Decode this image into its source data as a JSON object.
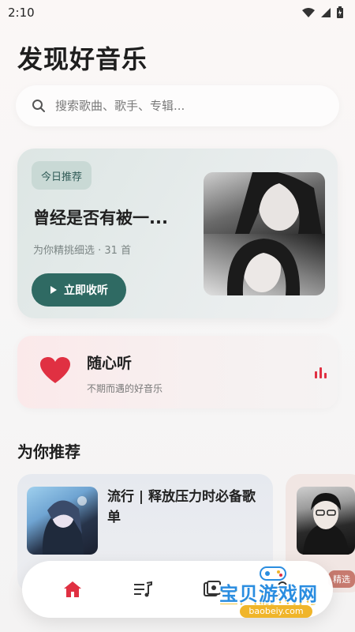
{
  "status_bar": {
    "time": "2:10"
  },
  "header": {
    "title": "发现好音乐"
  },
  "search": {
    "placeholder": "搜索歌曲、歌手、专辑..."
  },
  "daily_card": {
    "badge": "今日推荐",
    "title": "曾经是否有被一...",
    "subtitle": "为你精挑细选 · 31 首",
    "play_label": "立即收听"
  },
  "heart_card": {
    "title": "随心听",
    "subtitle": "不期而遇的好音乐"
  },
  "recommend": {
    "section_title": "为你推荐",
    "cards": [
      {
        "title": "流行 | 释放压力时必备歌单"
      },
      {
        "tag": "精选"
      }
    ]
  },
  "nav": {
    "items": [
      "home-icon",
      "playlist-icon",
      "library-icon",
      "profile-icon"
    ]
  },
  "colors": {
    "accent": "#e03042",
    "primary": "#2f6a63"
  },
  "watermark": {
    "text": "宝贝游戏网",
    "url": "baobeiy.com"
  }
}
